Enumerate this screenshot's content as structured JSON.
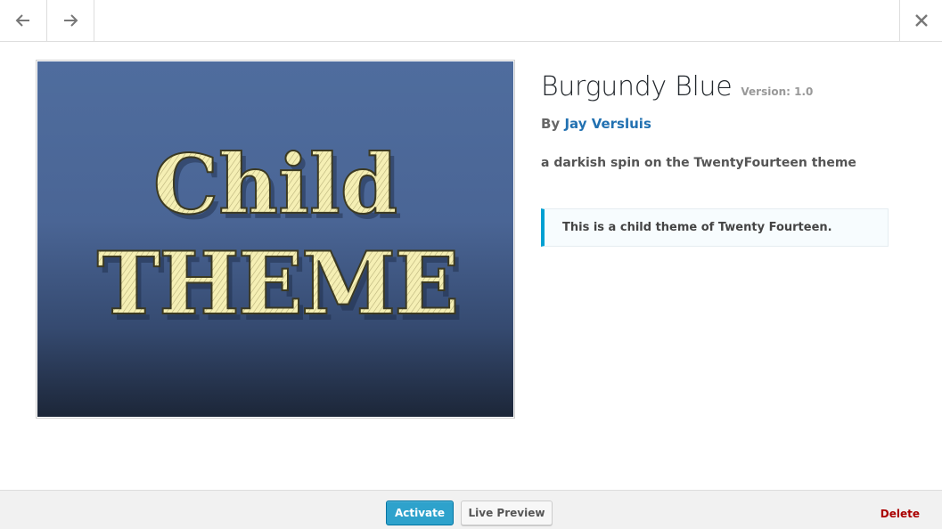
{
  "nav": {
    "previous_icon": "arrow-left-icon",
    "next_icon": "arrow-right-icon",
    "close_icon": "close-icon"
  },
  "screenshot": {
    "line1": "Child",
    "line2": "THEME"
  },
  "theme": {
    "name": "Burgundy Blue",
    "version": "Version: 1.0",
    "by_label": "By",
    "author": "Jay Versluis",
    "description": "a darkish spin on the TwentyFourteen theme",
    "parent_notice": "This is a child theme of Twenty Fourteen."
  },
  "actions": {
    "activate_label": "Activate",
    "live_preview_label": "Live Preview",
    "delete_label": "Delete"
  },
  "colors": {
    "accent": "#2ea2cc",
    "link": "#2271b1",
    "delete": "#aa0000",
    "notice_border": "#00a0d2",
    "screenshot_bg_top": "#4f6d9e",
    "screenshot_bg_bottom": "#1c2638",
    "screenshot_text": "#f5efb4"
  }
}
